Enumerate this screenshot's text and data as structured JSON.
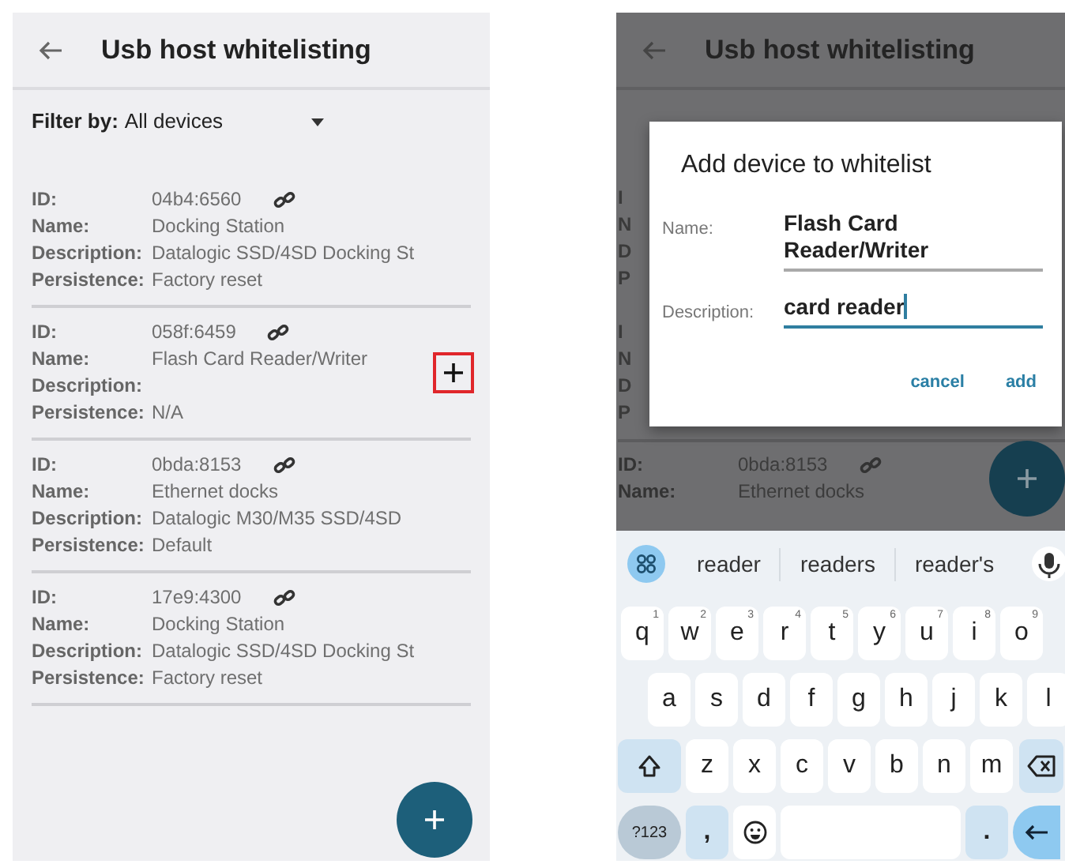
{
  "left_screen": {
    "header": {
      "title": "Usb host whitelisting"
    },
    "filter": {
      "label": "Filter by:",
      "value": "All devices"
    },
    "devices": [
      {
        "fields": [
          {
            "label": "ID:",
            "value": "04b4:6560"
          },
          {
            "label": "Name:",
            "value": "Docking Station"
          },
          {
            "label": "Description:",
            "value": "Datalogic SSD/4SD Docking St"
          },
          {
            "label": "Persistence:",
            "value": "Factory reset"
          }
        ],
        "add_shown": false
      },
      {
        "fields": [
          {
            "label": "ID:",
            "value": "058f:6459"
          },
          {
            "label": "Name:",
            "value": "Flash Card Reader/Writer"
          },
          {
            "label": "Description:"
          },
          {
            "label": "Persistence:",
            "value": "N/A"
          }
        ],
        "add_shown": true
      },
      {
        "fields": [
          {
            "label": "ID:",
            "value": "0bda:8153"
          },
          {
            "label": "Name:",
            "value": "Ethernet docks"
          },
          {
            "label": "Description:",
            "value": "Datalogic M30/M35 SSD/4SD"
          },
          {
            "label": "Persistence:",
            "value": "Default"
          }
        ],
        "add_shown": false
      },
      {
        "fields": [
          {
            "label": "ID:",
            "value": "17e9:4300"
          },
          {
            "label": "Name:",
            "value": "Docking Station"
          },
          {
            "label": "Description:",
            "value": "Datalogic SSD/4SD Docking St"
          },
          {
            "label": "Persistence:",
            "value": "Factory reset"
          }
        ],
        "add_shown": false
      }
    ]
  },
  "right_screen": {
    "header": {
      "title": "Usb host whitelisting"
    },
    "peeking_labels": [
      "I",
      "N",
      "D",
      "P",
      "I",
      "N",
      "D",
      "P"
    ],
    "dialog": {
      "title": "Add device to whitelist",
      "fields": [
        {
          "label": "Name:",
          "value": "Flash Card Reader/Writer",
          "focused": false
        },
        {
          "label": "Description:",
          "value": "card reader",
          "focused": true
        }
      ],
      "buttons": [
        "cancel",
        "add"
      ]
    },
    "visible_device": {
      "fields": [
        {
          "label": "ID:",
          "value": "0bda:8153"
        },
        {
          "label": "Name:",
          "value": "Ethernet docks"
        }
      ]
    },
    "keyboard": {
      "suggestions": [
        "reader",
        "readers",
        "reader's"
      ],
      "rows": [
        {
          "keys": [
            {
              "kind": "letter",
              "label": "q",
              "hint": "1"
            },
            {
              "kind": "letter",
              "label": "w",
              "hint": "2"
            },
            {
              "kind": "letter",
              "label": "e",
              "hint": "3"
            },
            {
              "kind": "letter",
              "label": "r",
              "hint": "4"
            },
            {
              "kind": "letter",
              "label": "t",
              "hint": "5"
            },
            {
              "kind": "letter",
              "label": "y",
              "hint": "6"
            },
            {
              "kind": "letter",
              "label": "u",
              "hint": "7"
            },
            {
              "kind": "letter",
              "label": "i",
              "hint": "8"
            },
            {
              "kind": "letter",
              "label": "o",
              "hint": "9"
            }
          ]
        },
        {
          "keys": [
            {
              "kind": "letter",
              "label": "a"
            },
            {
              "kind": "letter",
              "label": "s"
            },
            {
              "kind": "letter",
              "label": "d"
            },
            {
              "kind": "letter",
              "label": "f"
            },
            {
              "kind": "letter",
              "label": "g"
            },
            {
              "kind": "letter",
              "label": "h"
            },
            {
              "kind": "letter",
              "label": "j"
            },
            {
              "kind": "letter",
              "label": "k"
            },
            {
              "kind": "letter",
              "label": "l"
            }
          ]
        },
        {
          "keys": [
            {
              "kind": "shift"
            },
            {
              "kind": "letter",
              "label": "z"
            },
            {
              "kind": "letter",
              "label": "x"
            },
            {
              "kind": "letter",
              "label": "c"
            },
            {
              "kind": "letter",
              "label": "v"
            },
            {
              "kind": "letter",
              "label": "b"
            },
            {
              "kind": "letter",
              "label": "n"
            },
            {
              "kind": "letter",
              "label": "m"
            },
            {
              "kind": "backspace"
            }
          ]
        },
        {
          "keys": [
            {
              "kind": "symbols",
              "label": "?123"
            },
            {
              "kind": "punct",
              "label": ","
            },
            {
              "kind": "emoji"
            },
            {
              "kind": "space"
            },
            {
              "kind": "punct",
              "label": "."
            },
            {
              "kind": "enter"
            }
          ]
        }
      ]
    }
  }
}
